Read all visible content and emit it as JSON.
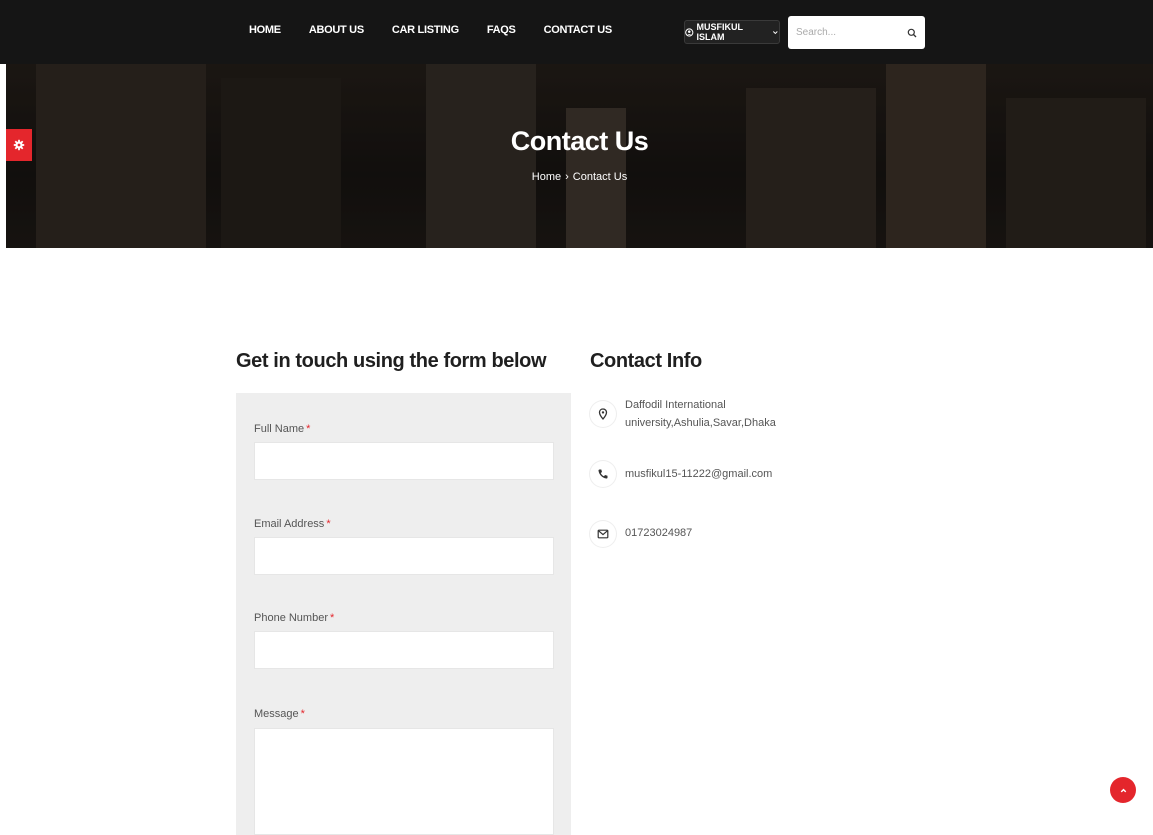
{
  "nav": {
    "items": [
      "HOME",
      "ABOUT US",
      "CAR LISTING",
      "FAQS",
      "CONTACT US"
    ],
    "user_label": "MUSFIKUL ISLAM",
    "search_placeholder": "Search..."
  },
  "banner": {
    "title": "Contact Us",
    "breadcrumb": [
      "Home",
      "Contact Us"
    ],
    "breadcrumb_separator": "›"
  },
  "form": {
    "heading": "Get in touch using the form below",
    "fields": [
      {
        "label": "Full Name",
        "required": "*",
        "value": ""
      },
      {
        "label": "Email Address",
        "required": "*",
        "value": ""
      },
      {
        "label": "Phone Number",
        "required": "*",
        "value": ""
      },
      {
        "label": "Message",
        "required": "*",
        "value": ""
      }
    ]
  },
  "contact_info": {
    "heading": "Contact Info",
    "items": [
      {
        "icon": "map-pin-icon",
        "text": "Daffodil International university,Ashulia,Savar,Dhaka"
      },
      {
        "icon": "phone-icon",
        "text": "musfikul15-11222@gmail.com"
      },
      {
        "icon": "envelope-icon",
        "text": "01723024987"
      }
    ]
  },
  "colors": {
    "accent": "#e4262c",
    "topbar": "#151515",
    "form_bg": "#eeeeee"
  }
}
